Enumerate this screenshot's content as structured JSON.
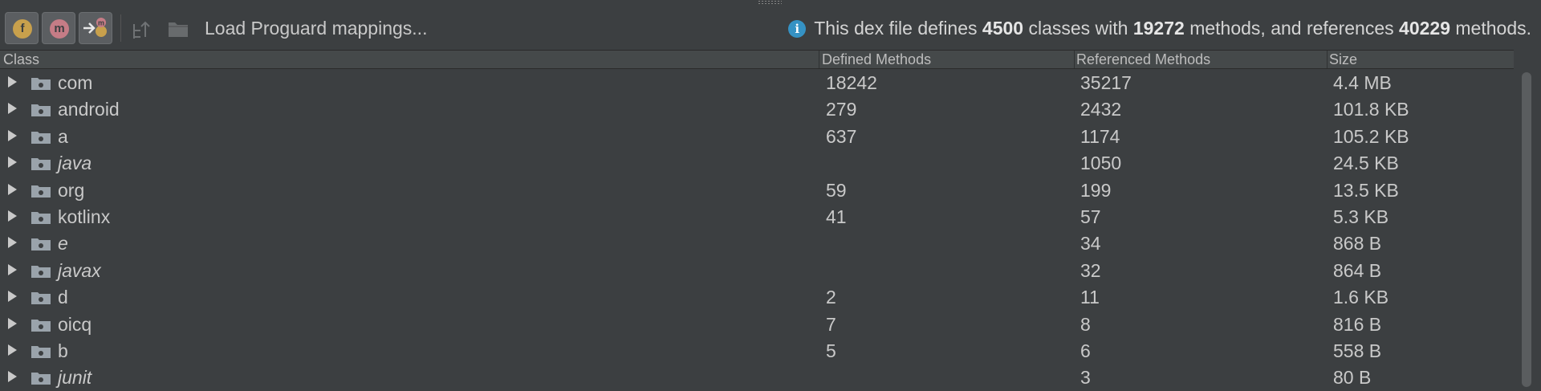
{
  "toolbar": {
    "filter_fields_label": "f",
    "filter_methods_label": "m",
    "load_proguard_label": "Load Proguard mappings...",
    "info": {
      "prefix": "This dex file defines ",
      "classes": "4500",
      "mid1": " classes with ",
      "methods": "19272",
      "mid2": " methods, and references ",
      "referenced": "40229",
      "suffix": " methods."
    }
  },
  "table": {
    "columns": [
      "Class",
      "Defined Methods",
      "Referenced Methods",
      "Size"
    ],
    "rows": [
      {
        "name": "com",
        "italic": false,
        "defined": "18242",
        "referenced": "35217",
        "size": "4.4 MB"
      },
      {
        "name": "android",
        "italic": false,
        "defined": "279",
        "referenced": "2432",
        "size": "101.8 KB"
      },
      {
        "name": "a",
        "italic": false,
        "defined": "637",
        "referenced": "1174",
        "size": "105.2 KB"
      },
      {
        "name": "java",
        "italic": true,
        "defined": "",
        "referenced": "1050",
        "size": "24.5 KB"
      },
      {
        "name": "org",
        "italic": false,
        "defined": "59",
        "referenced": "199",
        "size": "13.5 KB"
      },
      {
        "name": "kotlinx",
        "italic": false,
        "defined": "41",
        "referenced": "57",
        "size": "5.3 KB"
      },
      {
        "name": "e",
        "italic": true,
        "defined": "",
        "referenced": "34",
        "size": "868 B"
      },
      {
        "name": "javax",
        "italic": true,
        "defined": "",
        "referenced": "32",
        "size": "864 B"
      },
      {
        "name": "d",
        "italic": false,
        "defined": "2",
        "referenced": "11",
        "size": "1.6 KB"
      },
      {
        "name": "oicq",
        "italic": false,
        "defined": "7",
        "referenced": "8",
        "size": "816 B"
      },
      {
        "name": "b",
        "italic": false,
        "defined": "5",
        "referenced": "6",
        "size": "558 B"
      },
      {
        "name": "junit",
        "italic": true,
        "defined": "",
        "referenced": "3",
        "size": "80 B"
      }
    ]
  }
}
